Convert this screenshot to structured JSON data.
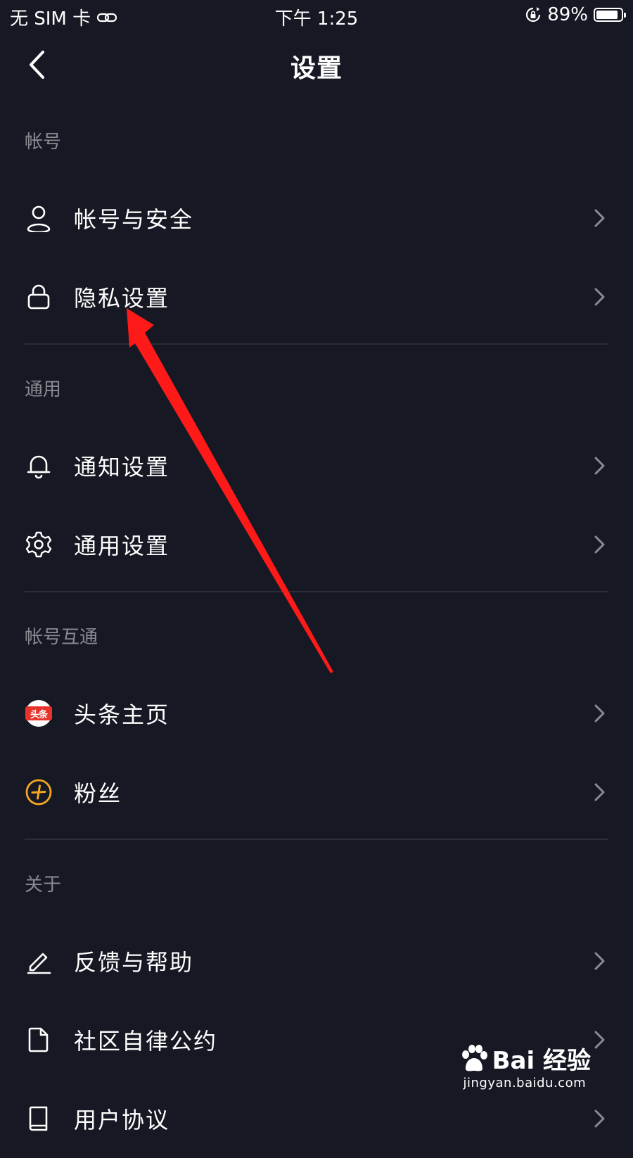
{
  "status_bar": {
    "carrier": "无 SIM 卡",
    "time": "下午 1:25",
    "battery_percent": "89%",
    "battery_level": 0.89
  },
  "header": {
    "title": "设置"
  },
  "sections": [
    {
      "title": "帐号",
      "items": [
        {
          "label": "帐号与安全",
          "icon": "user-icon"
        },
        {
          "label": "隐私设置",
          "icon": "lock-icon"
        }
      ]
    },
    {
      "title": "通用",
      "items": [
        {
          "label": "通知设置",
          "icon": "bell-icon"
        },
        {
          "label": "通用设置",
          "icon": "gear-icon"
        }
      ]
    },
    {
      "title": "帐号互通",
      "items": [
        {
          "label": "头条主页",
          "icon": "toutiao-icon",
          "icon_text": "头条"
        },
        {
          "label": "粉丝",
          "icon": "fans-plus-icon"
        }
      ]
    },
    {
      "title": "关于",
      "items": [
        {
          "label": "反馈与帮助",
          "icon": "pencil-icon"
        },
        {
          "label": "社区自律公约",
          "icon": "document-icon"
        },
        {
          "label": "用户协议",
          "icon": "book-icon"
        }
      ]
    }
  ],
  "watermark": {
    "brand": "Bai 经验",
    "url": "jingyan.baidu.com"
  },
  "colors": {
    "background": "#161823",
    "section_title": "#8a8b91",
    "divider": "#2b2d38",
    "annotation_arrow": "#ff1a1a",
    "fans_icon": "#f5a623",
    "toutiao_red": "#e8332c"
  }
}
